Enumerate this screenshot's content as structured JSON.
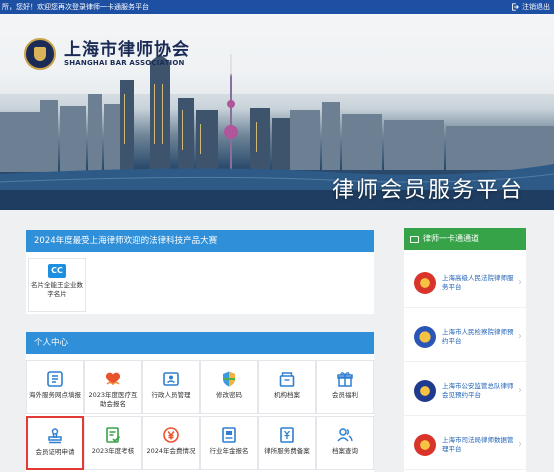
{
  "topbar": {
    "welcome": "所，您好！欢迎您再次登录律师一卡通服务平台",
    "logout": "注销退出"
  },
  "banner": {
    "logo_cn": "上海市律师协会",
    "logo_en": "SHANGHAI BAR ASSOCIATION",
    "platform_title": "律师会员服务平台"
  },
  "promo": {
    "title": "2024年度最受上海律师欢迎的法律科技产品大赛",
    "items": [
      {
        "badge": "CC",
        "label": "名片全能王企业数字名片"
      }
    ]
  },
  "personal_center": {
    "title": "个人中心",
    "items": [
      {
        "label": "海外服务网点填报",
        "icon": "grid-icon"
      },
      {
        "label": "2023年度医疗互助会报名",
        "icon": "heart-hands-icon"
      },
      {
        "label": "行政人员管理",
        "icon": "id-card-icon"
      },
      {
        "label": "修改密码",
        "icon": "shield-icon"
      },
      {
        "label": "机构档案",
        "icon": "archive-icon"
      },
      {
        "label": "会员福利",
        "icon": "gift-icon"
      },
      {
        "label": "会员证明申请",
        "icon": "stamp-icon"
      },
      {
        "label": "2023年度考核",
        "icon": "checklist-icon"
      },
      {
        "label": "2024年会费情况",
        "icon": "yuan-icon"
      },
      {
        "label": "行业年金报名",
        "icon": "document-icon"
      },
      {
        "label": "律所服务费备案",
        "icon": "fee-filing-icon"
      },
      {
        "label": "档案查询",
        "icon": "people-icon"
      }
    ]
  },
  "channel": {
    "title": "律师一卡通通道",
    "items": [
      {
        "label": "上海高级人民法院律师服务平台",
        "emblem": "court-emblem-icon"
      },
      {
        "label": "上海市人民检察院律师预约平台",
        "emblem": "procuratorate-emblem-icon"
      },
      {
        "label": "上海市公安监管总队律师会见预约平台",
        "emblem": "police-emblem-icon"
      },
      {
        "label": "上海市司法局律师数据管理平台",
        "emblem": "justice-emblem-icon"
      }
    ]
  },
  "colors": {
    "topbar": "#1d4fa3",
    "section_header": "#2f8fd8",
    "channel_header": "#37a349",
    "highlight": "#e53935"
  }
}
